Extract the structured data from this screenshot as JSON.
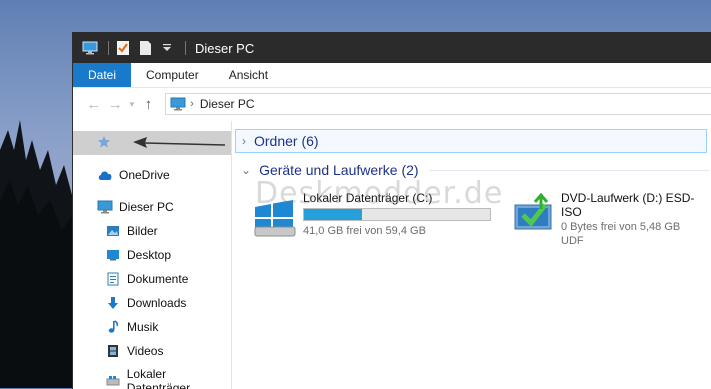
{
  "window": {
    "title": "Dieser PC"
  },
  "ribbon": {
    "tabs": [
      {
        "label": "Datei"
      },
      {
        "label": "Computer"
      },
      {
        "label": "Ansicht"
      }
    ]
  },
  "address": {
    "path": "Dieser PC"
  },
  "nav": {
    "items": [
      {
        "label": "OneDrive",
        "icon": "onedrive-cloud-icon"
      },
      {
        "label": "Dieser PC",
        "icon": "computer-icon"
      },
      {
        "label": "Bilder",
        "icon": "pictures-icon"
      },
      {
        "label": "Desktop",
        "icon": "desktop-icon"
      },
      {
        "label": "Dokumente",
        "icon": "documents-icon"
      },
      {
        "label": "Downloads",
        "icon": "downloads-arrow-icon"
      },
      {
        "label": "Musik",
        "icon": "music-note-icon"
      },
      {
        "label": "Videos",
        "icon": "videos-film-icon"
      },
      {
        "label": "Lokaler Datenträger",
        "icon": "drive-icon"
      }
    ]
  },
  "groups": {
    "folders": {
      "label": "Ordner (6)"
    },
    "devices": {
      "label": "Geräte und Laufwerke (2)"
    }
  },
  "drives": [
    {
      "name": "Lokaler Datenträger (C:)",
      "usage_fraction": 0.31,
      "free_text": "41,0 GB frei von 59,4 GB",
      "icon": "windows-drive-icon"
    },
    {
      "name": "DVD-Laufwerk (D:) ESD-ISO",
      "free_text": "0 Bytes frei von 5,48 GB",
      "fs": "UDF",
      "icon": "dvd-drive-icon"
    }
  ],
  "watermark": "Deskmodder.de",
  "colors": {
    "accent": "#1979ca",
    "titlebar": "#2b2b2b",
    "group_text": "#1e3287",
    "bar_fill": "#26a0da"
  }
}
